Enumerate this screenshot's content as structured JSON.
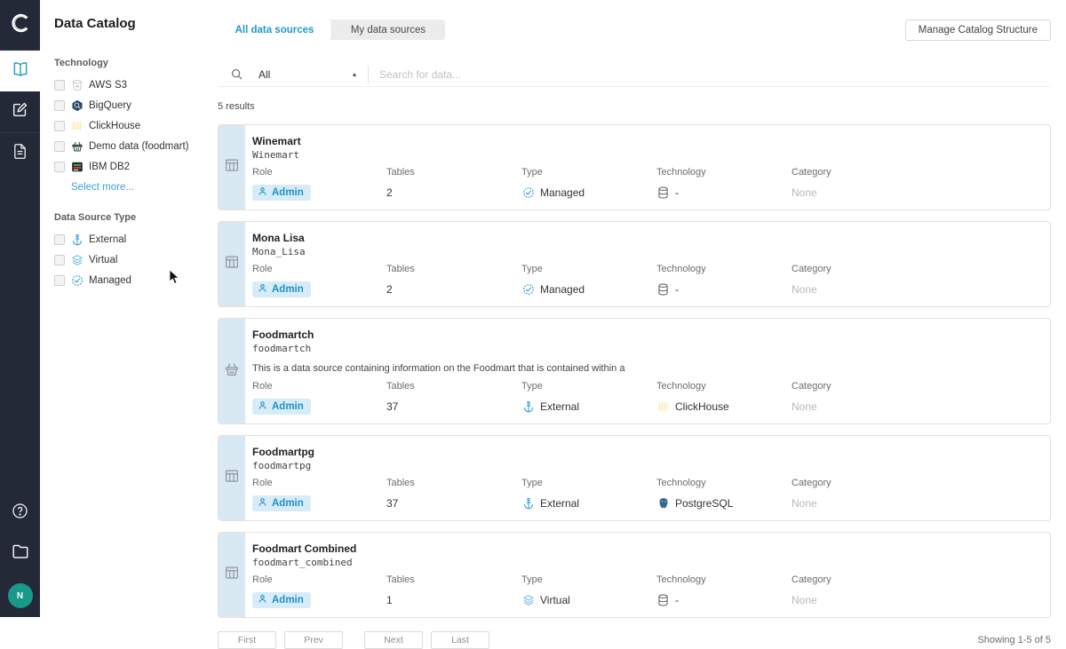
{
  "app": {
    "title": "Data Catalog",
    "logo_letter": "C",
    "avatar_initial": "N"
  },
  "sidebar": {
    "icons": [
      "catalog-book",
      "edit",
      "document",
      "help",
      "folder"
    ]
  },
  "filters": {
    "technology": {
      "label": "Technology",
      "items": [
        {
          "label": "AWS S3",
          "icon": "aws-s3"
        },
        {
          "label": "BigQuery",
          "icon": "bigquery"
        },
        {
          "label": "ClickHouse",
          "icon": "clickhouse"
        },
        {
          "label": "Demo data (foodmart)",
          "icon": "demo-data"
        },
        {
          "label": "IBM DB2",
          "icon": "ibm-db2"
        }
      ],
      "more_link": "Select more..."
    },
    "source_type": {
      "label": "Data Source Type",
      "items": [
        {
          "label": "External",
          "icon": "external"
        },
        {
          "label": "Virtual",
          "icon": "virtual"
        },
        {
          "label": "Managed",
          "icon": "managed"
        }
      ]
    }
  },
  "tabs": [
    {
      "label": "All data sources",
      "active": true
    },
    {
      "label": "My data sources",
      "active": false
    }
  ],
  "manage_button": "Manage Catalog Structure",
  "search": {
    "filter_value": "All",
    "placeholder": "Search for data..."
  },
  "results_count": "5 results",
  "card_columns": {
    "role": "Role",
    "tables": "Tables",
    "type": "Type",
    "technology": "Technology",
    "category": "Category"
  },
  "cards": [
    {
      "title": "Winemart",
      "code": "Winemart",
      "description": "",
      "icon": "table",
      "role": "Admin",
      "tables": "2",
      "type": "Managed",
      "type_icon": "managed",
      "technology": "-",
      "tech_icon": "database",
      "category": "None"
    },
    {
      "title": "Mona Lisa",
      "code": "Mona_Lisa",
      "description": "",
      "icon": "table",
      "role": "Admin",
      "tables": "2",
      "type": "Managed",
      "type_icon": "managed",
      "technology": "-",
      "tech_icon": "database",
      "category": "None"
    },
    {
      "title": "Foodmartch",
      "code": "foodmartch",
      "description": "This is a data source containing information on the Foodmart that is contained within a",
      "icon": "basket",
      "role": "Admin",
      "tables": "37",
      "type": "External",
      "type_icon": "external",
      "technology": "ClickHouse",
      "tech_icon": "clickhouse",
      "category": "None"
    },
    {
      "title": "Foodmartpg",
      "code": "foodmartpg",
      "description": "",
      "icon": "table",
      "role": "Admin",
      "tables": "37",
      "type": "External",
      "type_icon": "external",
      "technology": "PostgreSQL",
      "tech_icon": "postgresql",
      "category": "None"
    },
    {
      "title": "Foodmart Combined",
      "code": "foodmart_combined",
      "description": "",
      "icon": "table",
      "role": "Admin",
      "tables": "1",
      "type": "Virtual",
      "type_icon": "virtual",
      "technology": "-",
      "tech_icon": "database",
      "category": "None"
    }
  ],
  "pagination": {
    "first": "First",
    "prev": "Prev",
    "next": "Next",
    "last": "Last",
    "summary": "Showing 1-5 of 5"
  }
}
